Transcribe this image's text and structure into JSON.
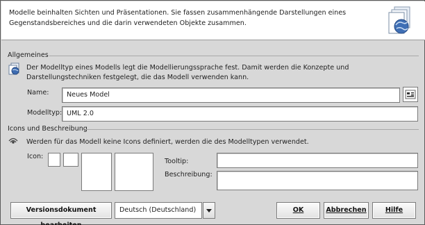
{
  "header": {
    "text": "Modelle beinhalten Sichten und Präsentationen. Sie fassen zusammenhängende Darstellungen eines Gegenstandsbereiches und die darin verwendeten Objekte zusammen.",
    "icon": "model-document-globe-icon"
  },
  "general": {
    "title": "Allgemeines",
    "description": "Der Modelltyp eines Modells legt die Modellierungssprache fest. Damit werden die Konzepte und Darstellungstechniken festgelegt, die das Modell verwenden kann.",
    "icon": "model-info-icon",
    "name_label": "Name:",
    "name_value": "Neues Model",
    "modeltype_label": "Modelltyp:",
    "modeltype_value": "UML 2.0"
  },
  "icons_section": {
    "title": "Icons und Beschreibung",
    "description": "Werden für das Modell keine Icons definiert, werden die des Modelltypen verwendet.",
    "icon": "eye-icon",
    "icon_label": "Icon:",
    "tooltip_label": "Tooltip:",
    "tooltip_value": "",
    "beschreibung_label": "Beschreibung:",
    "beschreibung_value": ""
  },
  "footer": {
    "version_button": "Versionsdokument bearbeiten",
    "language_value": "Deutsch (Deutschland)",
    "ok_label": "OK",
    "cancel_label": "Abbrechen",
    "help_label": "Hilfe"
  }
}
